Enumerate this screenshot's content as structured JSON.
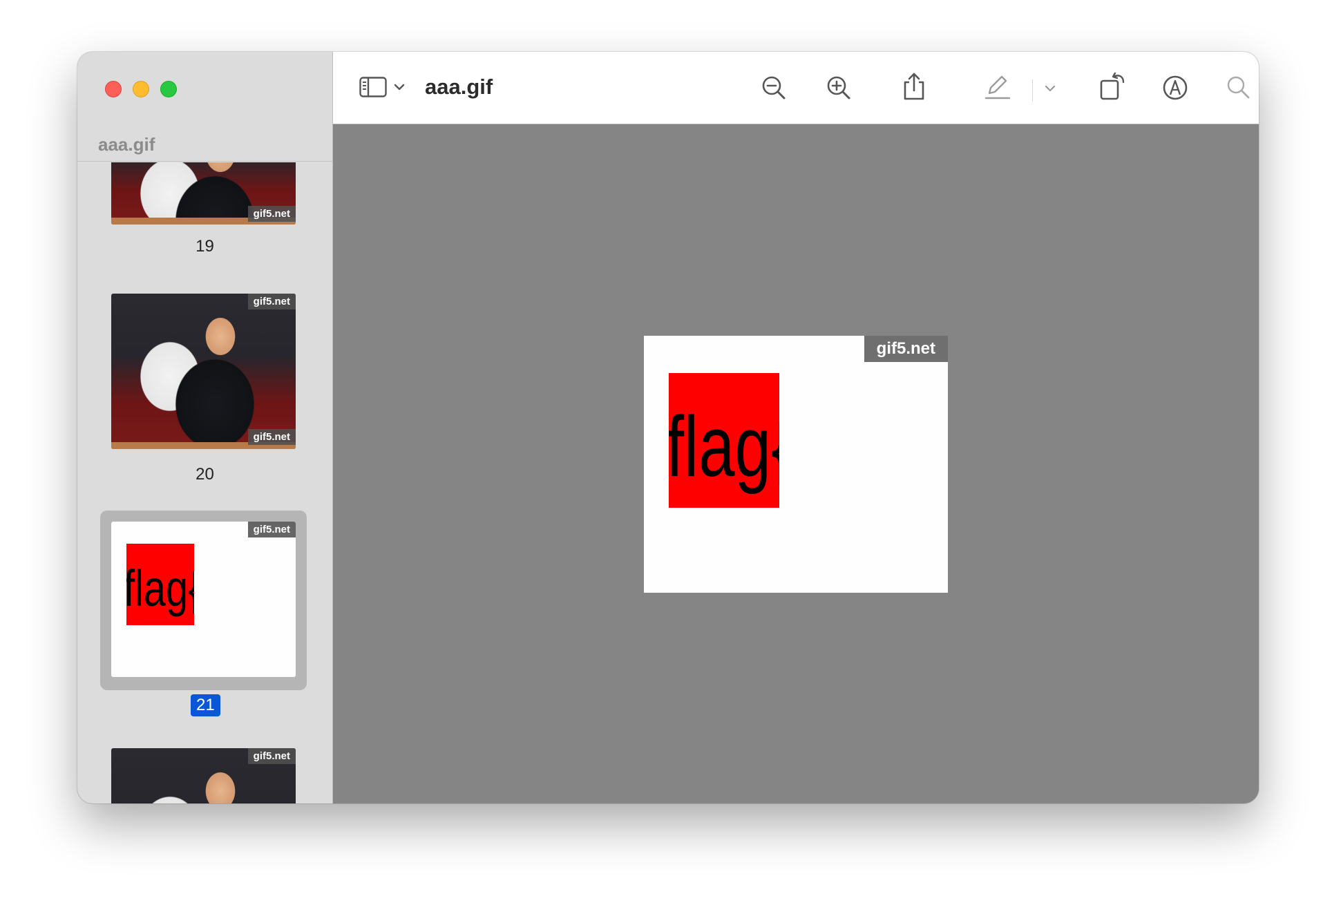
{
  "window": {
    "title": "aaa.gif"
  },
  "sidebar": {
    "title": "aaa.gif",
    "thumbnails": [
      {
        "label": "19",
        "watermark": "gif5.net"
      },
      {
        "label": "20",
        "watermark": "gif5.net"
      },
      {
        "label": "21",
        "watermark": "gif5.net",
        "selected": true,
        "text": "flag{"
      },
      {
        "label": "",
        "watermark": "gif5.net"
      }
    ]
  },
  "toolbar": {
    "icons": [
      "sidebar-icon",
      "chevron-down-icon",
      "zoom-out-icon",
      "zoom-in-icon",
      "share-icon",
      "highlight-pen-icon",
      "chevron-down-icon",
      "rotate-icon",
      "markup-icon",
      "search-icon"
    ]
  },
  "main_image": {
    "watermark": "gif5.net",
    "text": "flag{"
  },
  "colors": {
    "accent": "#0a56d6",
    "flag_red": "#ff0000",
    "canvas_bg": "#858585"
  }
}
